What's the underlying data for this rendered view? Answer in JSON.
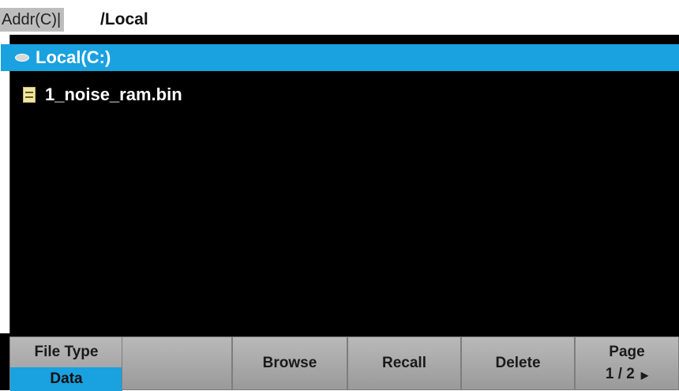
{
  "address": {
    "label": "Addr(C)|",
    "path": "/Local"
  },
  "browser": {
    "items": [
      {
        "label": "Local(C:)",
        "icon": "drive-icon",
        "selected": true
      },
      {
        "label": "1_noise_ram.bin",
        "icon": "file-icon",
        "selected": false
      }
    ]
  },
  "softkeys": {
    "file_type_label": "File Type",
    "file_type_value": "Data",
    "browse": "Browse",
    "recall": "Recall",
    "delete": "Delete",
    "page_label": "Page",
    "page_value": "1 / 2"
  },
  "colors": {
    "accent": "#1aa1e0",
    "background": "#000000",
    "key": "#b0b0b0"
  }
}
